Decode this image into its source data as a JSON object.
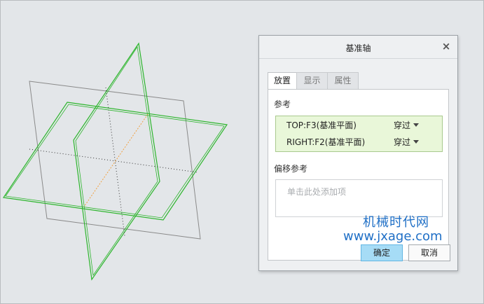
{
  "dialog": {
    "title": "基准轴",
    "close_glyph": "×",
    "tabs": [
      {
        "label": "放置",
        "active": true
      },
      {
        "label": "显示",
        "active": false
      },
      {
        "label": "属性",
        "active": false
      }
    ],
    "references_label": "参考",
    "references": [
      {
        "name": "TOP:F3(基准平面)",
        "type": "穿过"
      },
      {
        "name": "RIGHT:F2(基准平面)",
        "type": "穿过"
      }
    ],
    "offset_label": "偏移参考",
    "offset_placeholder": "单击此处添加项",
    "ok_label": "确定",
    "cancel_label": "取消"
  },
  "watermark": {
    "name": "机械时代网",
    "url": "www.jxage.com"
  },
  "colors": {
    "selected_plane": "#2db52d",
    "datum_plane": "#8a8a8a",
    "axis_preview": "#f0a040",
    "accent_button": "#a6dcf6",
    "reference_highlight": "#e9f7d9",
    "watermark": "#1f6fc6"
  }
}
